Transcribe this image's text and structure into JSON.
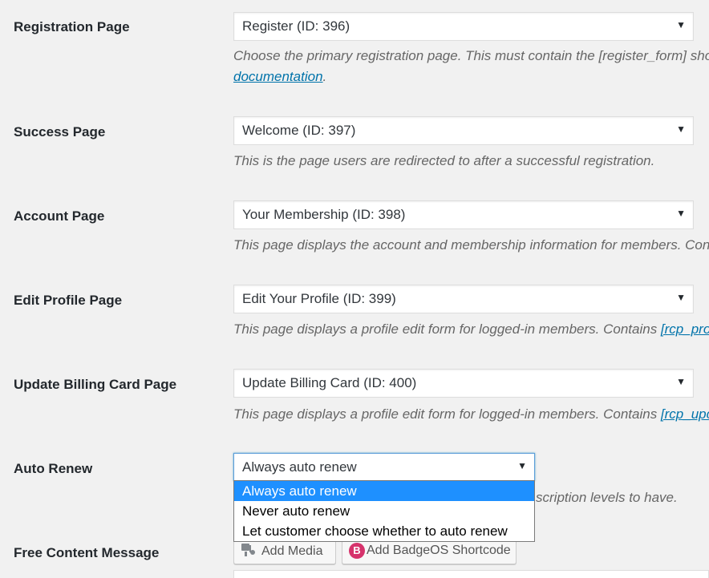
{
  "rows": [
    {
      "label": "Registration Page",
      "value": "Register (ID: 396)",
      "desc": "Choose the primary registration page. This must contain the [register_form] sho",
      "desc_link": "documentation",
      "desc_suffix": "."
    },
    {
      "label": "Success Page",
      "value": "Welcome (ID: 397)",
      "desc": "This is the page users are redirected to after a successful registration."
    },
    {
      "label": "Account Page",
      "value": "Your Membership (ID: 398)",
      "desc": "This page displays the account and membership information for members. Con"
    },
    {
      "label": "Edit Profile Page",
      "value": "Edit Your Profile (ID: 399)",
      "desc": "This page displays a profile edit form for logged-in members. Contains ",
      "desc_link": "[rcp_pro"
    },
    {
      "label": "Update Billing Card Page",
      "value": "Update Billing Card (ID: 400)",
      "desc": "This page displays a profile edit form for logged-in members. Contains ",
      "desc_link": "[rcp_upc"
    }
  ],
  "auto_renew": {
    "label": "Auto Renew",
    "value": "Always auto renew",
    "desc_fragment": "scription levels to have.",
    "options": [
      {
        "label": "Always auto renew",
        "selected": true
      },
      {
        "label": "Never auto renew",
        "selected": false
      },
      {
        "label": "Let customer choose whether to auto renew",
        "selected": false
      }
    ]
  },
  "free_content": {
    "label": "Free Content Message",
    "add_media": "Add Media",
    "add_badgeos": "Add BadgeOS Shortcode",
    "badgeos_icon_letter": "B"
  },
  "icons": {
    "dropdown_arrow": "▼",
    "media": "media-icon",
    "badgeos": "badgeos-icon"
  },
  "colors": {
    "link": "#0073aa",
    "selected_option": "#1e90ff",
    "badge": "#d6336c"
  }
}
